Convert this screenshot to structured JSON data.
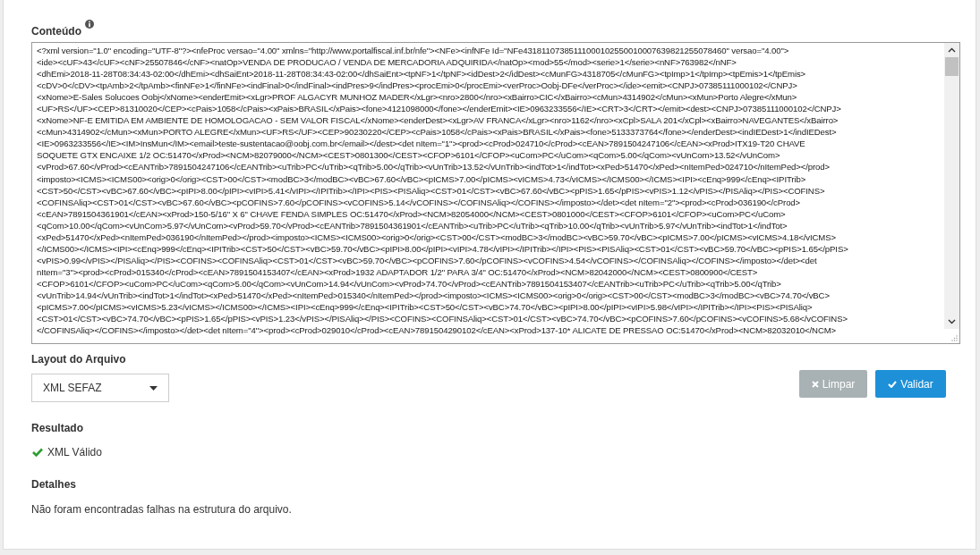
{
  "content": {
    "label": "Conteúdo",
    "lines": [
      "<?xml version=\"1.0\" encoding=\"UTF-8\"?><nfeProc versao=\"4.00\" xmlns=\"http://www.portalfiscal.inf.br/nfe\"><NFe><infNFe Id=\"NFe43181107385111000102550010007639821255078460\" versao=\"4.00\">",
      "<ide><cUF>43</cUF><cNF>25507846</cNF><natOp>VENDA DE PRODUCAO / VENDA DE MERCADORIA ADQUIRIDA</natOp><mod>55</mod><serie>1</serie><nNF>763982</nNF>",
      "<dhEmi>2018-11-28T08:34:43-02:00</dhEmi><dhSaiEnt>2018-11-28T08:34:43-02:00</dhSaiEnt><tpNF>1</tpNF><idDest>2</idDest><cMunFG>4318705</cMunFG><tpImp>1</tpImp><tpEmis>1</tpEmis>",
      "<cDV>0</cDV><tpAmb>2</tpAmb><finNFe>1</finNFe><indFinal>0</indFinal><indPres>9</indPres><procEmi>0</procEmi><verProc>Oobj-DFe</verProc></ide><emit><CNPJ>07385111000102</CNPJ>",
      "<xNome>E-Sales Solucoes Oobj</xNome><enderEmit><xLgr>PROF ALGACYR MUNHOZ MADER</xLgr><nro>2800</nro><xBairro>CIC</xBairro><cMun>4314902</cMun><xMun>Porto Alegre</xMun>",
      "<UF>RS</UF><CEP>81310020</CEP><cPais>1058</cPais><xPais>BRASIL</xPais><fone>4121098000</fone></enderEmit><IE>0963233556</IE><CRT>3</CRT></emit><dest><CNPJ>07385111000102</CNPJ>",
      "<xNome>NF-E EMITIDA EM AMBIENTE DE HOMOLOGACAO - SEM VALOR FISCAL</xNome><enderDest><xLgr>AV FRANCA</xLgr><nro>1162</nro><xCpl>SALA 201</xCpl><xBairro>NAVEGANTES</xBairro>",
      "<cMun>4314902</cMun><xMun>PORTO ALEGRE</xMun><UF>RS</UF><CEP>90230220</CEP><cPais>1058</cPais><xPais>BRASIL</xPais><fone>5133373764</fone></enderDest><indIEDest>1</indIEDest>",
      "<IE>0963233556</IE><IM>InsMun</IM><email>teste-sustentacao@oobj.com.br</email></dest><det nItem=\"1\"><prod><cProd>024710</cProd><cEAN>7891504247106</cEAN><xProd>ITX19-T20 CHAVE",
      "SOQUETE GTX ENCAIXE 1/2 OC:51470</xProd><NCM>82079000</NCM><CEST>0801300</CEST><CFOP>6101</CFOP><uCom>PC</uCom><qCom>5.00</qCom><vUnCom>13.52</vUnCom>",
      "<vProd>67.60</vProd><cEANTrib>7891504247106</cEANTrib><uTrib>PC</uTrib><qTrib>5.00</qTrib><vUnTrib>13.52</vUnTrib><indTot>1</indTot><xPed>51470</xPed><nItemPed>024710</nItemPed></prod>",
      "<imposto><ICMS><ICMS00><orig>0</orig><CST>00</CST><modBC>3</modBC><vBC>67.60</vBC><pICMS>7.00</pICMS><vICMS>4.73</vICMS></ICMS00></ICMS><IPI><cEnq>999</cEnq><IPITrib>",
      "<CST>50</CST><vBC>67.60</vBC><pIPI>8.00</pIPI><vIPI>5.41</vIPI></IPITrib></IPI><PIS><PISAliq><CST>01</CST><vBC>67.60</vBC><pPIS>1.65</pPIS><vPIS>1.12</vPIS></PISAliq></PIS><COFINS>",
      "<COFINSAliq><CST>01</CST><vBC>67.60</vBC><pCOFINS>7.60</pCOFINS><vCOFINS>5.14</vCOFINS></COFINSAliq></COFINS></imposto></det><det nItem=\"2\"><prod><cProd>036190</cProd>",
      "<cEAN>7891504361901</cEAN><xProd>150-5/16\" X 6\" CHAVE FENDA SIMPLES OC:51470</xProd><NCM>82054000</NCM><CEST>0801000</CEST><CFOP>6101</CFOP><uCom>PC</uCom>",
      "<qCom>10.00</qCom><vUnCom>5.97</vUnCom><vProd>59.70</vProd><cEANTrib>7891504361901</cEANTrib><uTrib>PC</uTrib><qTrib>10.00</qTrib><vUnTrib>5.97</vUnTrib><indTot>1</indTot>",
      "<xPed>51470</xPed><nItemPed>036190</nItemPed></prod><imposto><ICMS><ICMS00><orig>0</orig><CST>00</CST><modBC>3</modBC><vBC>59.70</vBC><pICMS>7.00</pICMS><vICMS>4.18</vICMS>",
      "</ICMS00></ICMS><IPI><cEnq>999</cEnq><IPITrib><CST>50</CST><vBC>59.70</vBC><pIPI>8.00</pIPI><vIPI>4.78</vIPI></IPITrib></IPI><PIS><PISAliq><CST>01</CST><vBC>59.70</vBC><pPIS>1.65</pPIS>",
      "<vPIS>0.99</vPIS></PISAliq></PIS><COFINS><COFINSAliq><CST>01</CST><vBC>59.70</vBC><pCOFINS>7.60</pCOFINS><vCOFINS>4.54</vCOFINS></COFINSAliq></COFINS></imposto></det><det",
      "nItem=\"3\"><prod><cProd>015340</cProd><cEAN>7891504153407</cEAN><xProd>1932 ADAPTADOR 1/2\" PARA 3/4\" OC:51470</xProd><NCM>82042000</NCM><CEST>0800900</CEST>",
      "<CFOP>6101</CFOP><uCom>PC</uCom><qCom>5.00</qCom><vUnCom>14.94</vUnCom><vProd>74.70</vProd><cEANTrib>7891504153407</cEANTrib><uTrib>PC</uTrib><qTrib>5.00</qTrib>",
      "<vUnTrib>14.94</vUnTrib><indTot>1</indTot><xPed>51470</xPed><nItemPed>015340</nItemPed></prod><imposto><ICMS><ICMS00><orig>0</orig><CST>00</CST><modBC>3</modBC><vBC>74.70</vBC>",
      "<pICMS>7.00</pICMS><vICMS>5.23</vICMS></ICMS00></ICMS><IPI><cEnq>999</cEnq><IPITrib><CST>50</CST><vBC>74.70</vBC><pIPI>8.00</pIPI><vIPI>5.98</vIPI></IPITrib></IPI><PIS><PISAliq>",
      "<CST>01</CST><vBC>74.70</vBC><pPIS>1.65</pPIS><vPIS>1.23</vPIS></PISAliq></PIS><COFINS><COFINSAliq><CST>01</CST><vBC>74.70</vBC><pCOFINS>7.60</pCOFINS><vCOFINS>5.68</vCOFINS>",
      "</COFINSAliq></COFINS></imposto></det><det nItem=\"4\"><prod><cProd>029010</cProd><cEAN>7891504290102</cEAN><xProd>137-10* ALICATE DE PRESSAO OC:51470</xProd><NCM>82032010</NCM>"
    ]
  },
  "layout": {
    "label": "Layout do Arquivo",
    "value": "XML SEFAZ"
  },
  "buttons": [
    {
      "label": "Limpar",
      "kind": "clear"
    },
    {
      "label": "Validar",
      "kind": "validate"
    }
  ],
  "result": {
    "label": "Resultado",
    "valid": true,
    "message": "XML Válido"
  },
  "details": {
    "label": "Detalhes",
    "text": "Não foram encontradas falhas na estrutura do arquivo."
  }
}
